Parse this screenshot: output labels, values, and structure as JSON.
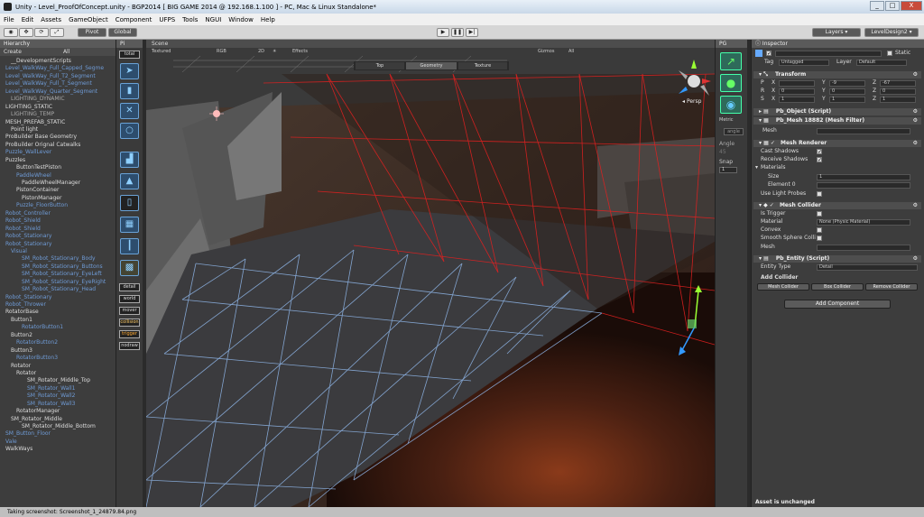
{
  "window": {
    "title": "Unity - Level_ProofOfConcept.unity - BGP2014 [ BIG GAME 2014 @ 192.168.1.100 ] - PC, Mac & Linux Standalone*",
    "buttons": [
      "_",
      "□",
      "X"
    ]
  },
  "menu": [
    "File",
    "Edit",
    "Assets",
    "GameObject",
    "Component",
    "UFPS",
    "Tools",
    "NGUI",
    "Window",
    "Help"
  ],
  "toolbar": {
    "pivot": "Pivot",
    "global": "Global",
    "layers": "Layers",
    "layout": "LevelDesign2"
  },
  "hierarchy": {
    "tab": "Hierarchy",
    "create": "Create",
    "search": "All",
    "items": [
      {
        "label": "__DevelopmentScripts",
        "indent": 1,
        "color": "white"
      },
      {
        "label": "Level_WalkWay_Full_Capped_Segme",
        "indent": 0,
        "color": "blue"
      },
      {
        "label": "Level_WalkWay_Full_T2_Segment",
        "indent": 0,
        "color": "blue"
      },
      {
        "label": "Level_WalkWay_Full_T_Segment",
        "indent": 0,
        "color": "blue"
      },
      {
        "label": "Level_WalkWay_Quarter_Segment",
        "indent": 0,
        "color": "blue"
      },
      {
        "label": "LIGHTING_DYNAMIC",
        "indent": 1,
        "color": "dim"
      },
      {
        "label": "LIGHTING_STATIC",
        "indent": 0,
        "color": "white"
      },
      {
        "label": "LIGHTING_TEMP",
        "indent": 1,
        "color": "dim"
      },
      {
        "label": "MESH_PREFAB_STATIC",
        "indent": 0,
        "color": "white"
      },
      {
        "label": "Point light",
        "indent": 1,
        "color": "white"
      },
      {
        "label": "ProBuilder Base Geometry",
        "indent": 0,
        "color": "white"
      },
      {
        "label": "ProBuilder Orignal Catwalks",
        "indent": 0,
        "color": "white"
      },
      {
        "label": "Puzzle_WallLever",
        "indent": 0,
        "color": "blue"
      },
      {
        "label": "Puzzles",
        "indent": 0,
        "color": "white"
      },
      {
        "label": "ButtonTestPiston",
        "indent": 2,
        "color": "white"
      },
      {
        "label": "PaddleWheel",
        "indent": 2,
        "color": "blue"
      },
      {
        "label": "PaddleWheelManager",
        "indent": 3,
        "color": "white"
      },
      {
        "label": "PistonContainer",
        "indent": 2,
        "color": "white"
      },
      {
        "label": "PistonManager",
        "indent": 3,
        "color": "white"
      },
      {
        "label": "Puzzle_FloorButton",
        "indent": 2,
        "color": "blue"
      },
      {
        "label": "Robot_Controller",
        "indent": 0,
        "color": "blue"
      },
      {
        "label": "Robot_Shield",
        "indent": 0,
        "color": "blue"
      },
      {
        "label": "Robot_Shield",
        "indent": 0,
        "color": "blue"
      },
      {
        "label": "Robot_Stationary",
        "indent": 0,
        "color": "blue"
      },
      {
        "label": "Robot_Stationary",
        "indent": 0,
        "color": "blue"
      },
      {
        "label": "Visual",
        "indent": 1,
        "color": "blue"
      },
      {
        "label": "SM_Robot_Stationary_Body",
        "indent": 3,
        "color": "blue"
      },
      {
        "label": "SM_Robot_Stationary_Buttons",
        "indent": 3,
        "color": "blue"
      },
      {
        "label": "SM_Robot_Stationary_EyeLeft",
        "indent": 3,
        "color": "blue"
      },
      {
        "label": "SM_Robot_Stationary_EyeRight",
        "indent": 3,
        "color": "blue"
      },
      {
        "label": "SM_Robot_Stationary_Head",
        "indent": 3,
        "color": "blue"
      },
      {
        "label": "Robot_Stationary",
        "indent": 0,
        "color": "blue"
      },
      {
        "label": "Robot_Thrower",
        "indent": 0,
        "color": "blue"
      },
      {
        "label": "RotatorBase",
        "indent": 0,
        "color": "white"
      },
      {
        "label": "Button1",
        "indent": 1,
        "color": "white"
      },
      {
        "label": "RotatorButton1",
        "indent": 3,
        "color": "blue"
      },
      {
        "label": "Button2",
        "indent": 1,
        "color": "white"
      },
      {
        "label": "RotatorButton2",
        "indent": 2,
        "color": "blue"
      },
      {
        "label": "Button3",
        "indent": 1,
        "color": "white"
      },
      {
        "label": "RotatorButton3",
        "indent": 2,
        "color": "blue"
      },
      {
        "label": "Rotator",
        "indent": 1,
        "color": "white"
      },
      {
        "label": "Rotator",
        "indent": 2,
        "color": "white"
      },
      {
        "label": "SM_Rotator_Middle_Top",
        "indent": 4,
        "color": "white"
      },
      {
        "label": "SM_Rotator_Wall1",
        "indent": 4,
        "color": "blue"
      },
      {
        "label": "SM_Rotator_Wall2",
        "indent": 4,
        "color": "blue"
      },
      {
        "label": "SM_Rotator_Wall3",
        "indent": 4,
        "color": "blue"
      },
      {
        "label": "RotatorManager",
        "indent": 2,
        "color": "white"
      },
      {
        "label": "SM_Rotator_Middle",
        "indent": 1,
        "color": "white"
      },
      {
        "label": "SM_Rotator_Middle_Bottom",
        "indent": 3,
        "color": "white"
      },
      {
        "label": "SM_Button_Floor",
        "indent": 0,
        "color": "blue"
      },
      {
        "label": "Vale",
        "indent": 0,
        "color": "blue"
      },
      {
        "label": "WalkWays",
        "indent": 0,
        "color": "white"
      }
    ]
  },
  "tools": {
    "tab": "Pi",
    "total": "total",
    "labels": [
      "detail",
      "world",
      "mover",
      "collision",
      "trigger",
      "nodraw"
    ]
  },
  "scene": {
    "tab": "Scene",
    "shading": "Textured",
    "render": "RGB",
    "mode2d": "2D",
    "effects": "Effects",
    "gizmos": "Gizmos",
    "search": "All",
    "view_tabs": [
      "Top",
      "Geometry",
      "Texture"
    ],
    "persp": "Persp"
  },
  "pg": {
    "tab": "PG",
    "metric": "Metric",
    "angle_btn": "angle",
    "angle": "Angle",
    "angle_val": "45",
    "snap": "Snap",
    "snap_val": "1"
  },
  "inspector": {
    "tab": "Inspector",
    "static": "Static",
    "tag_label": "Tag",
    "tag": "Untagged",
    "layer_label": "Layer",
    "layer": "Default",
    "transform": {
      "title": "Transform",
      "p": {
        "x": "",
        "y": "-9",
        "z": "-67"
      },
      "r": {
        "x": "0",
        "y": "0",
        "z": "0"
      },
      "s": {
        "x": "1",
        "y": "1",
        "z": "1"
      }
    },
    "pb_object": "Pb_Object (Script)",
    "pb_mesh": "Pb_Mesh 18882 (Mesh Filter)",
    "mesh_label": "Mesh",
    "mesh_renderer": "Mesh Renderer",
    "cast_shadows": "Cast Shadows",
    "receive_shadows": "Receive Shadows",
    "materials": "Materials",
    "size": "Size",
    "size_val": "1",
    "element0": "Element 0",
    "use_light_probes": "Use Light Probes",
    "mesh_collider": "Mesh Collider",
    "is_trigger": "Is Trigger",
    "material": "Material",
    "material_val": "None (Physic Material)",
    "convex": "Convex",
    "smooth_sphere": "Smooth Sphere Colli",
    "mesh2": "Mesh",
    "pb_entity": "Pb_Entity (Script)",
    "entity_type": "Entity Type",
    "entity_type_val": "Detail",
    "add_collider": "Add Collider",
    "collider_btns": [
      "Mesh Collider",
      "Box Collider",
      "Remove Collider"
    ],
    "add_component": "Add Component",
    "asset_status": "Asset is unchanged"
  },
  "status": "Taking screenshot: Screenshot_1_24879.84.png"
}
